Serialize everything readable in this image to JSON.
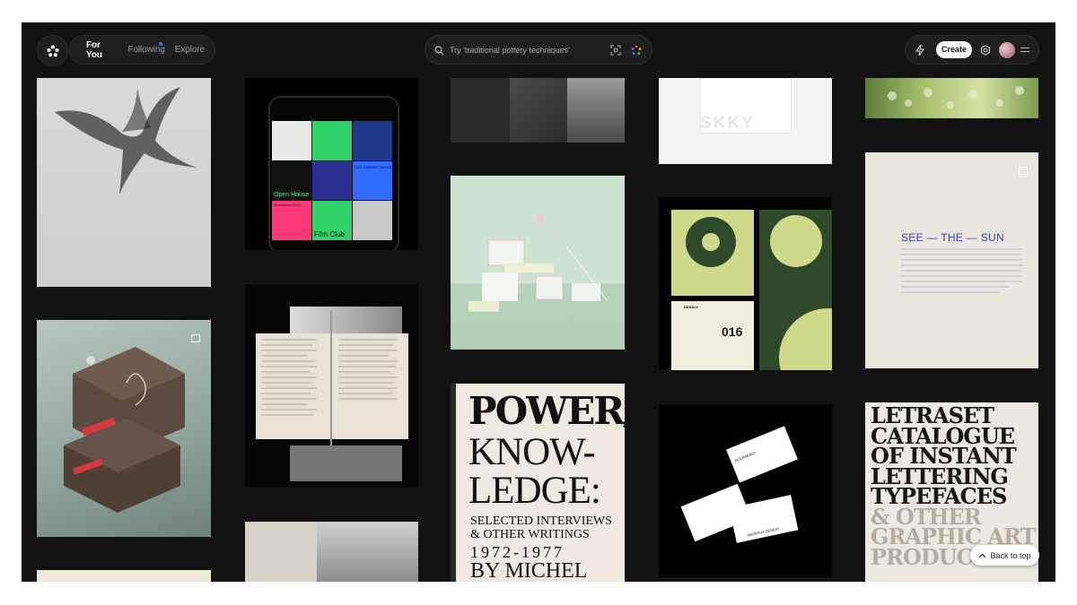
{
  "nav": {
    "tabs": [
      {
        "label": "For You",
        "active": true
      },
      {
        "label": "Following",
        "active": false
      },
      {
        "label": "Explore",
        "active": false
      }
    ]
  },
  "search": {
    "placeholder": "Try 'traditional pottery techniques'"
  },
  "header": {
    "create_label": "Create"
  },
  "footer": {
    "back_to_top": "Back to top"
  },
  "cards": {
    "phone_tiles": [
      "Open House",
      "Graduation 2022",
      "DEN DANSKE FILMSKOLE",
      "NATIONAL FILM SCHOOL OF DENMARK",
      "Film Club"
    ],
    "skky_logo": "SKKY",
    "see_the_sun": "SEE — THE — SUN",
    "power_book": {
      "line1": "POWER/",
      "line2": "KNOW-",
      "line3": "LEDGE:",
      "line4": "SELECTED INTERVIEWS",
      "line5": "& OTHER WRITINGS",
      "line6": "1972-1977",
      "line7": "BY MICHEL"
    },
    "letraset": [
      "LETRASET",
      "CATALOGUE",
      "OF INSTANT",
      "LETTERING",
      "TYPEFACES",
      "& OTHER",
      "GRAPHIC ART",
      "PRODUCTS"
    ],
    "poster_number": "016",
    "poster_word": "DEADLY",
    "business_card": {
      "name": "ALEJANDRO",
      "company": "MAORTUA",
      "role": "ART DIRECTOR",
      "studio": "MAORTUA DESIGN",
      "phone": "+34(0)24645789",
      "city": "MONEJARO",
      "year": "EST.2023"
    }
  },
  "colors": {
    "background": "#121212",
    "accent_dot": "#4f6bff",
    "create_button": "#ffffff"
  }
}
